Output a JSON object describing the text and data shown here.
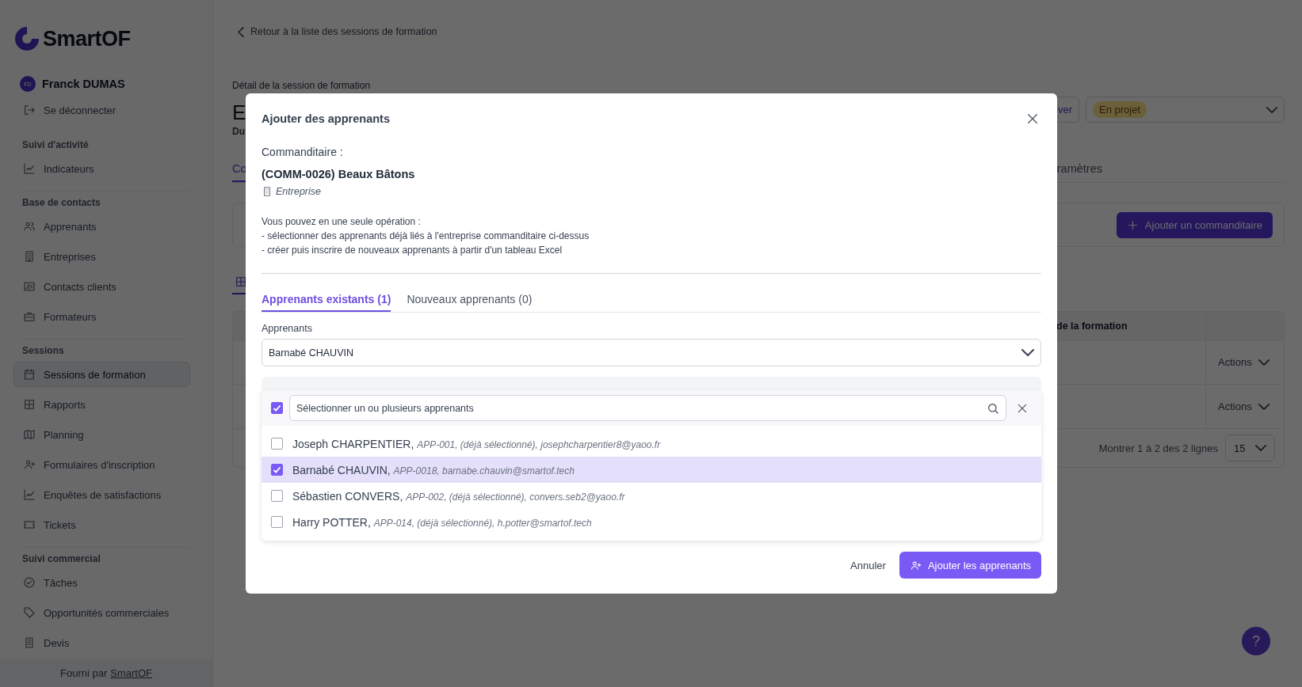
{
  "sidebar": {
    "logo": "SmartOF",
    "user": {
      "initials": "FD",
      "name": "Franck DUMAS"
    },
    "logout": "Se déconnecter",
    "sections": [
      {
        "title": "Suivi d'activité",
        "items": [
          {
            "label": "Indicateurs",
            "selected": false
          }
        ]
      },
      {
        "title": "Base de contacts",
        "items": [
          {
            "label": "Apprenants",
            "selected": false
          },
          {
            "label": "Entreprises",
            "selected": false
          },
          {
            "label": "Contacts clients",
            "selected": false
          },
          {
            "label": "Formateurs",
            "selected": false
          }
        ]
      },
      {
        "title": "Sessions",
        "items": [
          {
            "label": "Sessions de formation",
            "selected": true
          },
          {
            "label": "Rapports",
            "selected": false
          },
          {
            "label": "Planning",
            "selected": false
          },
          {
            "label": "Formulaires d'inscription",
            "selected": false
          },
          {
            "label": "Enquêtes de satisfactions",
            "selected": false
          },
          {
            "label": "Tickets",
            "selected": false
          }
        ]
      },
      {
        "title": "Suivi commercial",
        "items": [
          {
            "label": "Tâches",
            "selected": false
          },
          {
            "label": "Opportunités commerciales",
            "selected": false
          },
          {
            "label": "Devis",
            "selected": false
          }
        ]
      }
    ],
    "footer": {
      "text": "Fourni par",
      "link": "SmartOF"
    }
  },
  "page": {
    "back_link": "Retour à la liste des sessions de formation",
    "breadcrumb": "Détail de la session de formation",
    "title": "E",
    "subtitle": "Du",
    "header_button": "ver",
    "status": "En projet",
    "tabs": [
      {
        "label": "Co",
        "selected": true
      },
      {
        "label": "ramètres",
        "selected": false
      }
    ],
    "add_sponsor_button": "Ajouter un commanditaire",
    "table": {
      "column": "de la formation",
      "rows": [
        {
          "action": "Actions"
        },
        {
          "action": "Actions"
        }
      ],
      "summary": "Montrer 1 à 2 des 2 lignes",
      "page_size": "15"
    },
    "help": "?"
  },
  "modal": {
    "title": "Ajouter des apprenants",
    "sponsor_label": "Commanditaire :",
    "sponsor_name": "(COMM-0026) Beaux Bâtons",
    "sponsor_type": "Entreprise",
    "intro": [
      "Vous pouvez en une seule opération :",
      "- sélectionner des apprenants déjà liés à l'entreprise commanditaire ci-dessus",
      "- créer puis inscrire de nouveaux apprenants à partir d'un tableau Excel"
    ],
    "tabs": [
      {
        "label": "Apprenants existants (1)",
        "selected": true
      },
      {
        "label": "Nouveaux apprenants (0)",
        "selected": false
      }
    ],
    "field_label": "Apprenants",
    "field_value": "Barnabé CHAUVIN",
    "dropdown": {
      "select_all_checked": true,
      "search_placeholder": "Sélectionner un ou plusieurs apprenants",
      "options": [
        {
          "text": "Joseph CHARPENTIER, *APP-001, (déjà sélectionné), josephcharpentier8@yaoo.fr*",
          "checked": false,
          "selected": false
        },
        {
          "text": "Barnabé CHAUVIN, *APP-0018, barnabe.chauvin@smartof.tech*",
          "checked": true,
          "selected": true
        },
        {
          "text": "Sébastien CONVERS, *APP-002, (déjà sélectionné), convers.seb2@yaoo.fr*",
          "checked": false,
          "selected": false
        },
        {
          "text": "Harry POTTER, *APP-014, (déjà sélectionné), h.potter@smartof.tech*",
          "checked": false,
          "selected": false
        }
      ]
    },
    "cancel": "Annuler",
    "submit": "Ajouter les apprenants"
  }
}
